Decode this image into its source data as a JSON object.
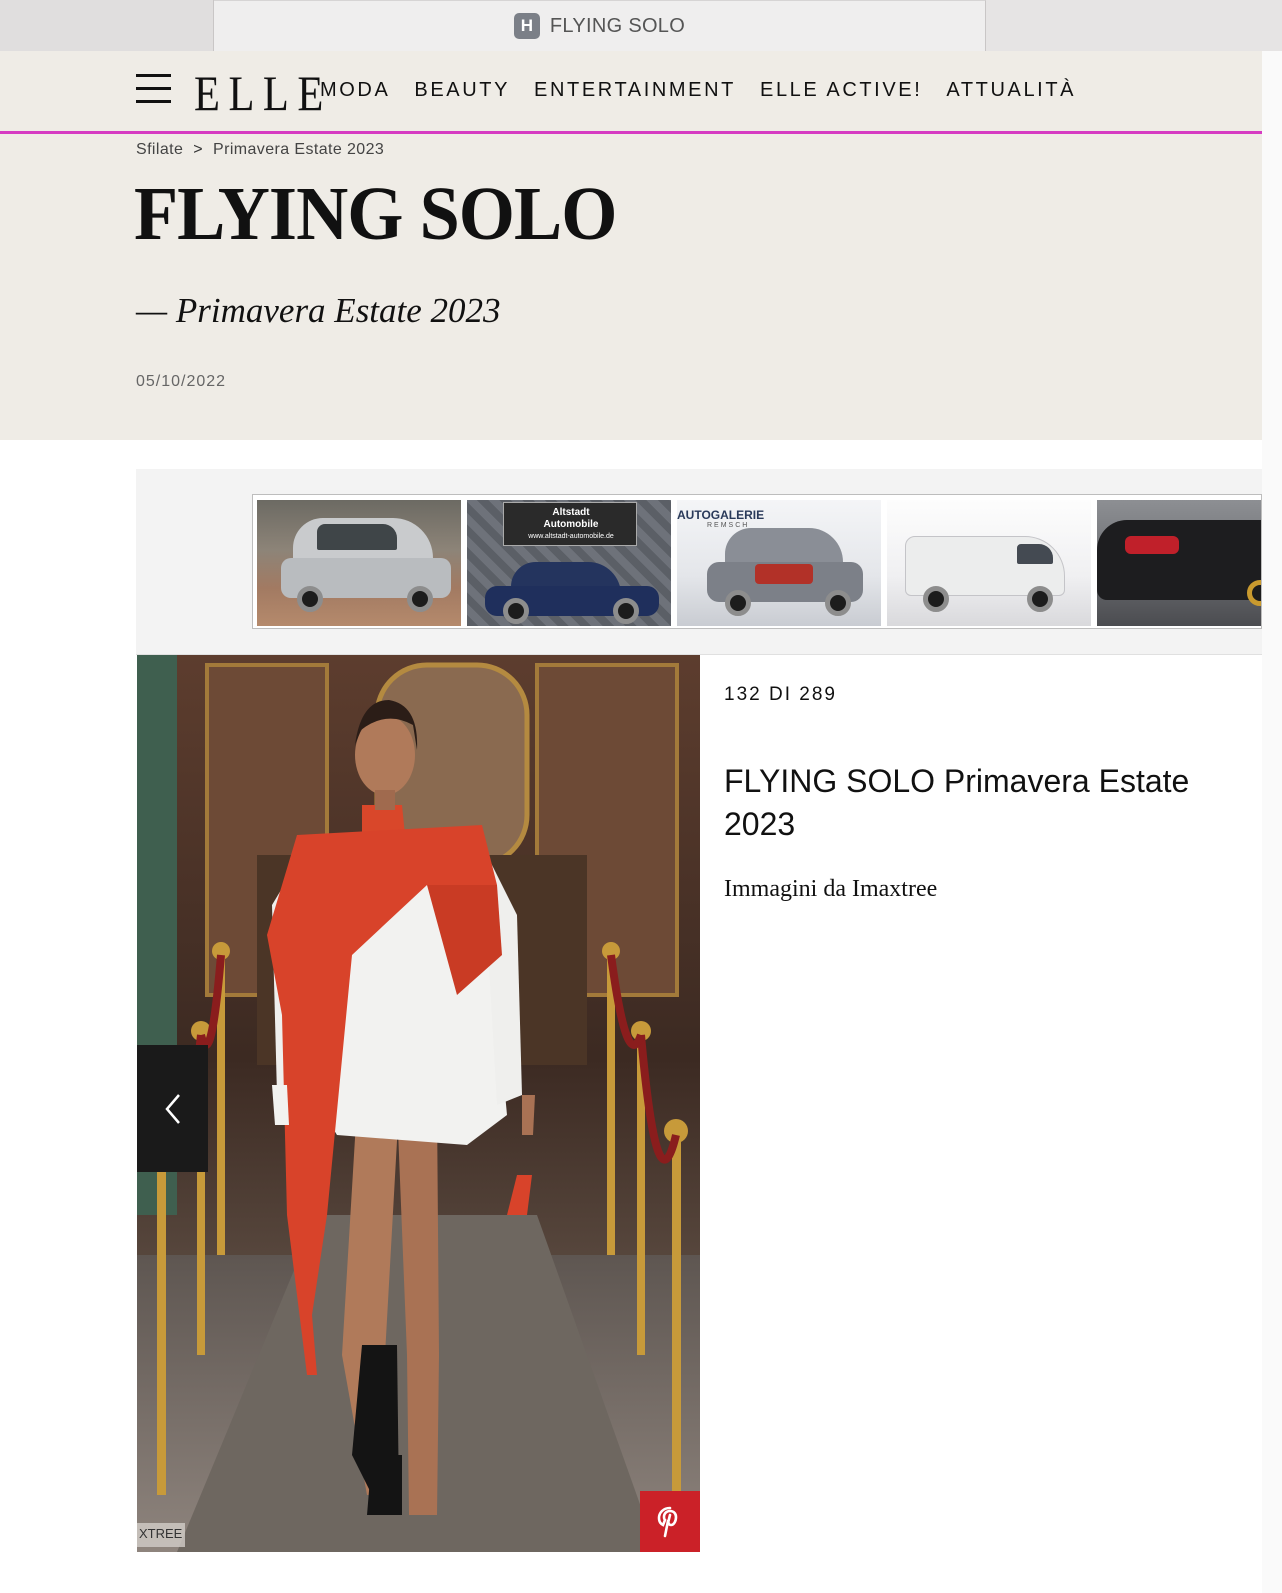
{
  "browser": {
    "favicon_letter": "H",
    "tab_title": "FLYING SOLO"
  },
  "nav": {
    "logo": "ELLE",
    "links": [
      "MODA",
      "BEAUTY",
      "ENTERTAINMENT",
      "ELLE ACTIVE!",
      "ATTUALITÀ"
    ],
    "accent_color": "#d63bc2"
  },
  "breadcrumb": {
    "items": [
      "Sfilate",
      "Primavera Estate 2023"
    ],
    "separator": ">"
  },
  "article": {
    "title": "FLYING SOLO",
    "subtitle": "— Primavera Estate 2023",
    "date": "05/10/2022"
  },
  "ad": {
    "items": [
      {
        "name": "silver-hatchback",
        "color": "#b9bcbf"
      },
      {
        "name": "blue-sedan",
        "color": "#1f2f5c",
        "label_1": "Altstadt",
        "label_2": "Automobile",
        "url": "www.altstadt-automobile.de"
      },
      {
        "name": "grey-hatchback",
        "color": "#7c8088",
        "label_1": "AUTOGALERIE",
        "label_2": "REMSCH"
      },
      {
        "name": "white-van",
        "color": "#eceded"
      },
      {
        "name": "black-coupe",
        "color": "#1d1d1f"
      }
    ]
  },
  "gallery": {
    "counter": "132 DI 289",
    "slide_title": "FLYING SOLO Primavera Estate 2023",
    "credit": "Immagini da Imaxtree",
    "photo_tag": "XTREE",
    "pinterest_color": "#cb2128"
  }
}
